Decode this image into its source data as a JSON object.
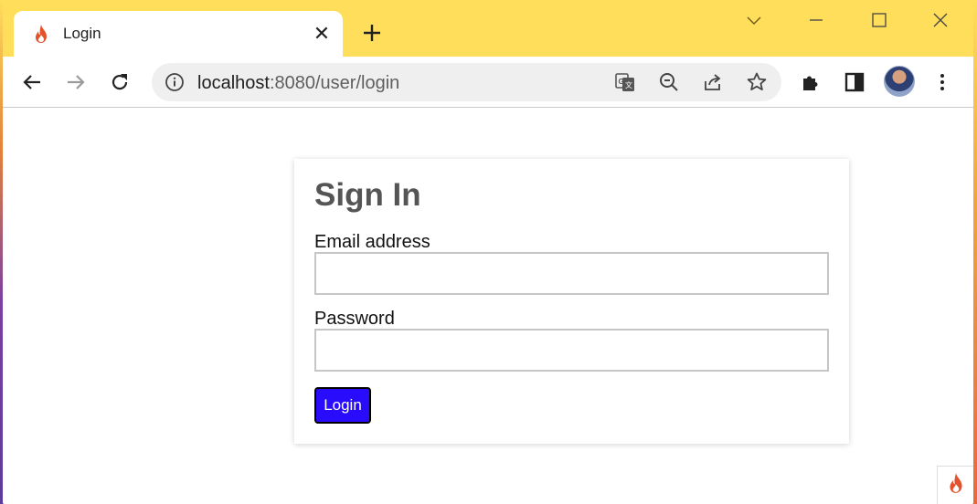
{
  "browser": {
    "tab": {
      "title": "Login",
      "close_icon": "close-icon",
      "favicon": "flame-icon"
    },
    "new_tab_icon": "plus-icon",
    "window_controls": [
      "chevron-down-icon",
      "minimize-icon",
      "maximize-icon",
      "close-icon"
    ],
    "toolbar": {
      "back": "back-arrow-icon",
      "forward": "forward-arrow-icon",
      "reload": "reload-icon",
      "omnibox": {
        "host": "localhost",
        "path": ":8080/user/login"
      },
      "omnibox_icons": [
        "translate-icon",
        "zoom-out-icon",
        "share-icon",
        "star-icon"
      ],
      "right_icons": [
        "extensions-icon",
        "side-panel-icon",
        "avatar",
        "menu-icon"
      ]
    },
    "colors": {
      "frame": "#ffde5c"
    }
  },
  "page": {
    "heading": "Sign In",
    "email_label": "Email address",
    "email_value": "",
    "password_label": "Password",
    "password_value": "",
    "login_button": "Login",
    "colors": {
      "button": "#2a0cfc",
      "heading": "#555555"
    },
    "corner_icon": "flame-icon"
  }
}
